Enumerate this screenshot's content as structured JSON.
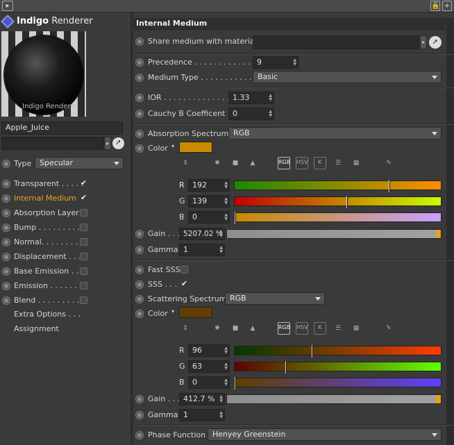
{
  "app": {
    "title_bold": "Indigo",
    "title_rest": " Renderer",
    "preview_watermark": "Indigo Renderer"
  },
  "left": {
    "material_name": "Apple_Juice",
    "type_label": "Type",
    "type_value": "Specular",
    "channels": [
      {
        "label": "Transparent . . . . .",
        "checked": true,
        "active": false
      },
      {
        "label": "Internal Medium",
        "checked": true,
        "active": true
      },
      {
        "label": "Absorption Layer",
        "checked": false,
        "active": false
      },
      {
        "label": "Bump . . . . . . . . .",
        "checked": false,
        "active": false
      },
      {
        "label": "Normal. . . . . . . . .",
        "checked": false,
        "active": false
      },
      {
        "label": "Displacement . . . .",
        "checked": false,
        "active": false
      },
      {
        "label": "Base Emission . . . .",
        "checked": false,
        "active": false
      },
      {
        "label": "Emission . . . . . . .",
        "checked": false,
        "active": false
      },
      {
        "label": "Blend . . . . . . . . .",
        "checked": false,
        "active": false
      }
    ],
    "extra_options": "Extra Options . . .",
    "assignment": "Assignment"
  },
  "panel": {
    "header": "Internal Medium",
    "share_label": "Share medium with material",
    "precedence_label": "Precedence . . . . . . . . . . . . . .",
    "precedence_value": "9",
    "medium_type_label": "Medium Type . . . . . . . . . . .",
    "medium_type_value": "Basic",
    "ior_label": "IOR . . . . . . . . . . . . . . .",
    "ior_value": "1.33",
    "cauchy_label": "Cauchy B Coefficent",
    "cauchy_value": "0",
    "absorption_label": "Absorption Spectrum",
    "absorption_value": "RGB",
    "color_label": "Color",
    "color1_hex": "#c88a00",
    "mode_rgb": "RGB",
    "mode_hsv": "HSV",
    "mode_k": "K",
    "r_label": "R",
    "g_label": "G",
    "b_label": "B",
    "abs_r": "192",
    "abs_g": "139",
    "abs_b": "0",
    "abs_r_frac": 0.753,
    "abs_g_frac": 0.545,
    "abs_b_frac": 0.0,
    "gain_label": "Gain . . .",
    "gain1_value": "5207.02 %",
    "gamma_label": "Gamma",
    "gamma1_value": "1",
    "fast_sss_label": "Fast SSS",
    "fast_sss_checked": false,
    "sss_label": "SSS . . .",
    "sss_checked": true,
    "scattering_label": "Scattering Spectrum",
    "scattering_value": "RGB",
    "color2_hex": "#603f00",
    "sc_r": "96",
    "sc_g": "63",
    "sc_b": "0",
    "sc_r_frac": 0.376,
    "sc_g_frac": 0.247,
    "sc_b_frac": 0.0,
    "gain2_value": "412.7 %",
    "gamma2_value": "1",
    "phase_label": "Phase Function",
    "phase_value": "Henyey Greenstein"
  }
}
